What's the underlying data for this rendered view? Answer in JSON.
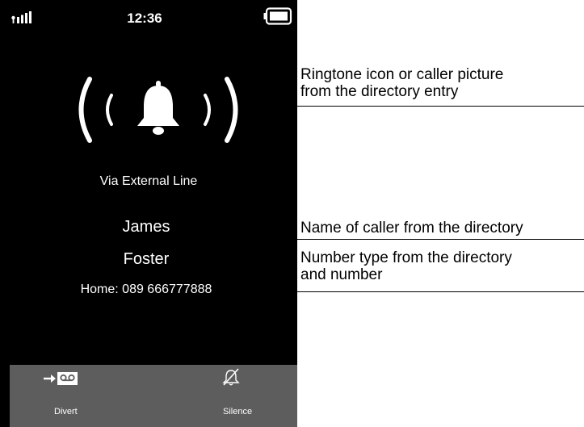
{
  "phone": {
    "status_bar": {
      "time": "12:36",
      "signal_icon": "signal-strength-icon",
      "battery_icon": "battery-full-icon"
    },
    "incoming_call": {
      "ring_icon": "ringing-bell-icon",
      "via": "Via External Line",
      "caller_first_name": "James",
      "caller_last_name": "Foster",
      "number_line": "Home: 089 666777888"
    },
    "softkeys": [
      {
        "label": "Divert",
        "icon": "divert-to-voicemail-icon"
      },
      {
        "label": "Silence",
        "icon": "mute-bell-icon"
      }
    ]
  },
  "annotations": [
    {
      "line1": "Ringtone icon or caller picture",
      "line2": "from the directory entry"
    },
    {
      "line1": "Name of caller from the directory"
    },
    {
      "line1": "Number type from the directory",
      "line2": "and number"
    }
  ],
  "colors": {
    "screen_background": "#000000",
    "softkey_background": "#5d5d5d",
    "text_on_screen": "#ffffff",
    "annotation_text": "#000000"
  }
}
